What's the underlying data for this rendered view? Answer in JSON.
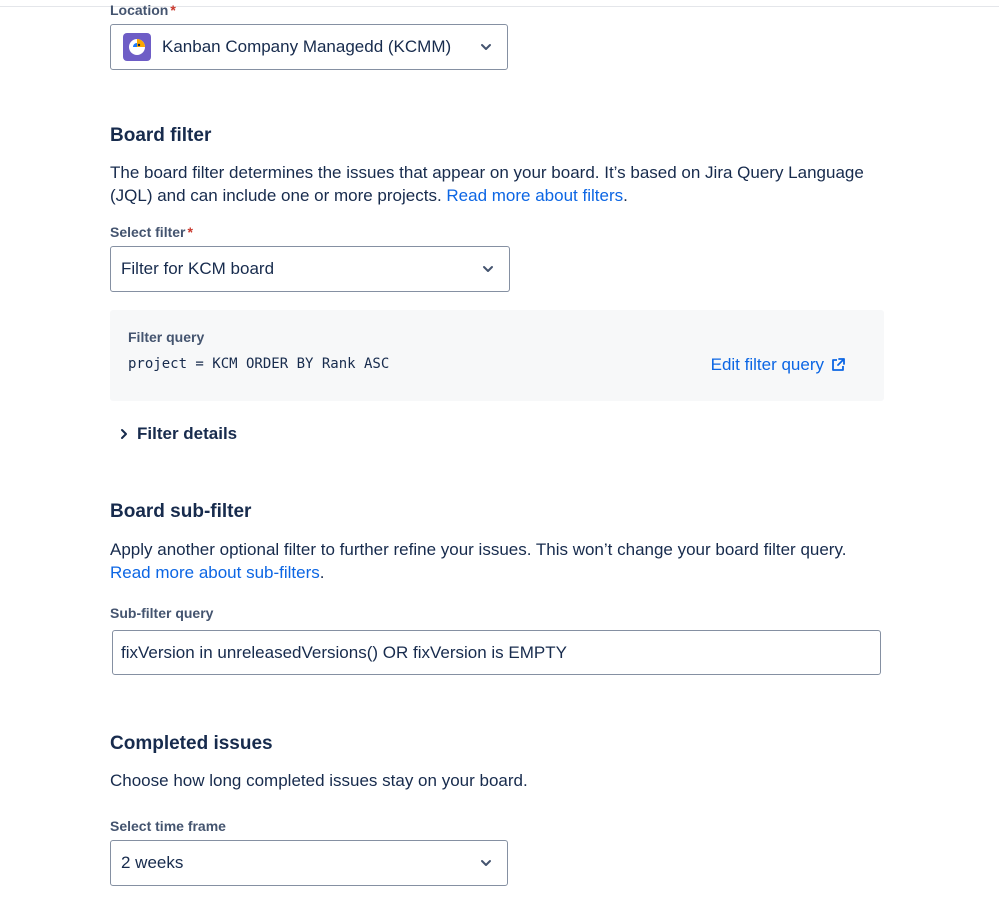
{
  "location": {
    "label": "Location",
    "required_mark": "*",
    "selected": "Kanban Company Managedd (KCMM)",
    "project_icon": "parrot-avatar-icon"
  },
  "board_filter": {
    "title": "Board filter",
    "description": "The board filter determines the issues that appear on your board. It’s based on Jira Query Language (JQL) and can include one or more projects.",
    "link": "Read more about filters",
    "after_link": ".",
    "select_label": "Select filter",
    "required_mark": "*",
    "selected": "Filter for KCM board",
    "query_label": "Filter query",
    "query": "project = KCM ORDER BY Rank ASC",
    "edit_link": "Edit filter query",
    "details_toggle": "Filter details"
  },
  "sub_filter": {
    "title": "Board sub-filter",
    "description": "Apply another optional filter to further refine your issues. This won’t change your board filter query.",
    "link": "Read more about sub-filters",
    "after_link": ".",
    "input_label": "Sub-filter query",
    "input_value": "fixVersion in unreleasedVersions() OR fixVersion is EMPTY"
  },
  "completed": {
    "title": "Completed issues",
    "description": "Choose how long completed issues stay on your board.",
    "select_label": "Select time frame",
    "selected": "2 weeks"
  },
  "colors": {
    "link": "#0C66E4",
    "text": "#172B4D",
    "required": "#C9372C",
    "project_icon_bg": "#6E5DC6",
    "query_bg": "#F7F8F9"
  }
}
